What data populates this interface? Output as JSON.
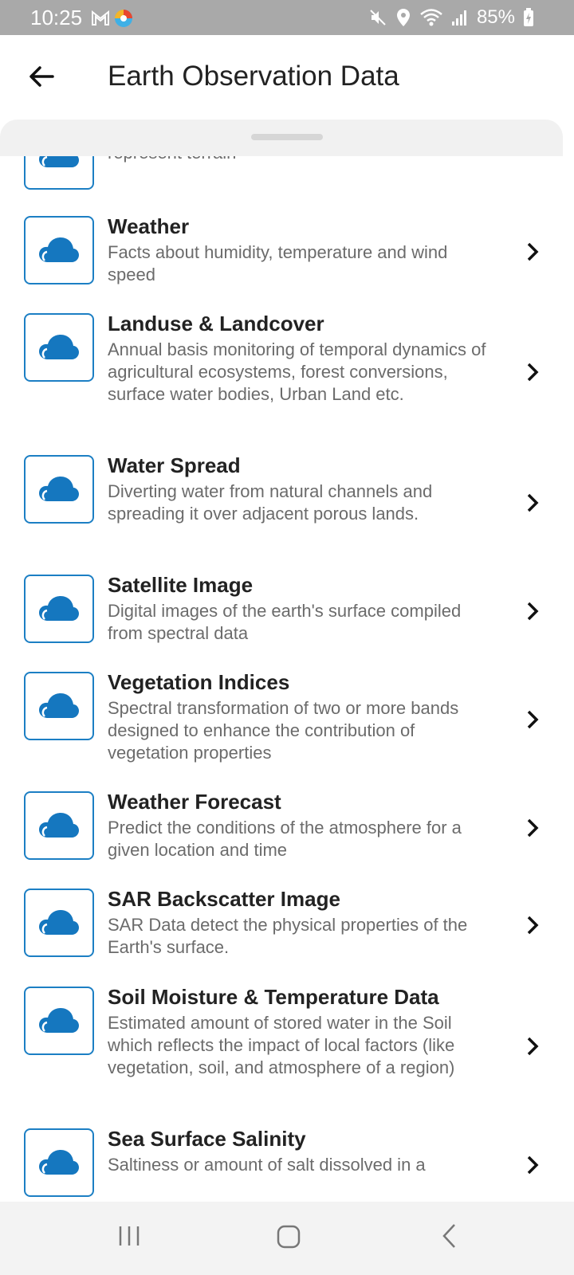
{
  "status": {
    "time": "10:25",
    "battery": "85%"
  },
  "header": {
    "title": "Earth Observation Data"
  },
  "colors": {
    "accent": "#1c7fc4",
    "icon_fill": "#1577bf"
  },
  "items": [
    {
      "title": "",
      "desc": "Graphics representation of elevation data to represent terrain",
      "icon": "cloud-icon"
    },
    {
      "title": "Weather",
      "desc": "Facts about humidity, temperature and wind speed",
      "icon": "cloud-icon"
    },
    {
      "title": "Landuse & Landcover",
      "desc": "Annual basis monitoring of temporal dynamics of agricultural ecosystems, forest conversions, surface water bodies, Urban Land etc.",
      "icon": "cloud-icon"
    },
    {
      "title": "Water Spread",
      "desc": "Diverting water from natural channels and spreading it over adjacent porous lands.",
      "icon": "cloud-icon"
    },
    {
      "title": "Satellite Image",
      "desc": "Digital images of the earth's surface compiled from spectral data",
      "icon": "cloud-icon"
    },
    {
      "title": "Vegetation Indices",
      "desc": "Spectral transformation of two or more bands designed to enhance the contribution of vegetation properties",
      "icon": "cloud-icon"
    },
    {
      "title": "Weather Forecast",
      "desc": "Predict the conditions of the atmosphere for a given location and time",
      "icon": "cloud-icon"
    },
    {
      "title": "SAR Backscatter Image",
      "desc": "SAR Data detect the physical properties of the Earth's surface.",
      "icon": "cloud-icon"
    },
    {
      "title": "Soil Moisture & Temperature Data",
      "desc": "Estimated amount of stored water in the Soil which reflects the impact of local factors (like vegetation, soil, and atmosphere of a region)",
      "icon": "cloud-icon"
    },
    {
      "title": "Sea Surface Salinity",
      "desc": "Saltiness or amount of salt dissolved in a",
      "icon": "cloud-icon"
    }
  ]
}
